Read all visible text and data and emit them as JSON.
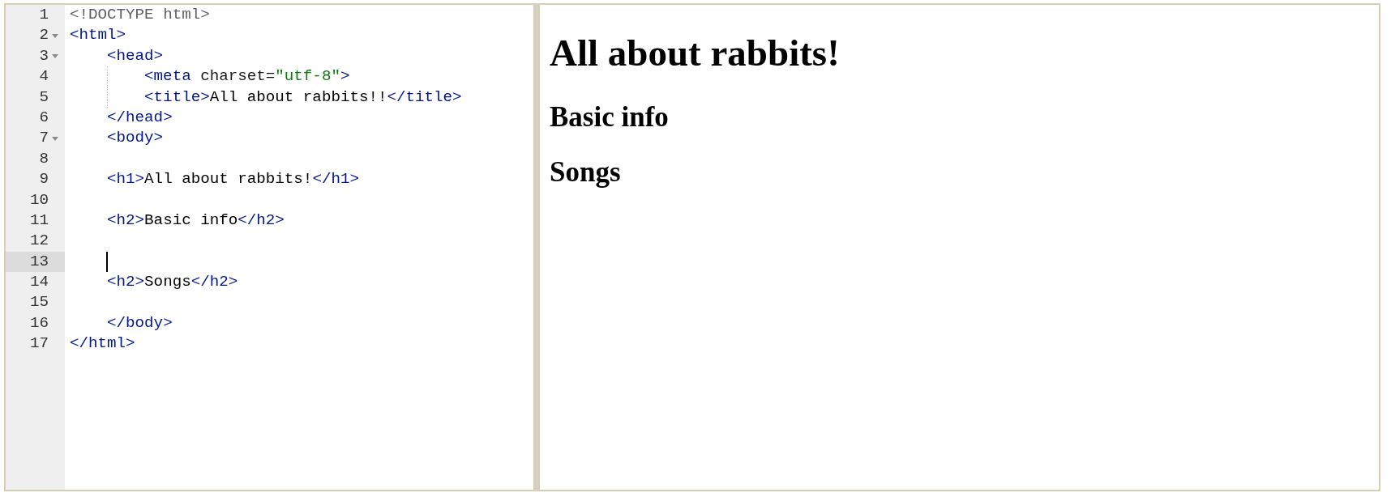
{
  "editor": {
    "lines": [
      {
        "number": "1",
        "foldable": false,
        "active": false,
        "tokens": [
          {
            "kind": "doctype",
            "text": "<!DOCTYPE html>"
          }
        ]
      },
      {
        "number": "2",
        "foldable": true,
        "active": false,
        "tokens": [
          {
            "kind": "tag",
            "text": "<html>"
          }
        ],
        "children": [
          {
            "number": "3",
            "foldable": true,
            "active": false,
            "tokens": [
              {
                "kind": "tag",
                "text": "<head>"
              }
            ],
            "children": [
              {
                "number": "4",
                "foldable": false,
                "active": false,
                "tokens": [
                  {
                    "kind": "tag",
                    "text": "<meta"
                  },
                  {
                    "kind": "attribute",
                    "text": " charset"
                  },
                  {
                    "kind": "punct",
                    "text": "="
                  },
                  {
                    "kind": "string",
                    "text": "\"utf-8\""
                  },
                  {
                    "kind": "tag",
                    "text": ">"
                  }
                ]
              },
              {
                "number": "5",
                "foldable": false,
                "active": false,
                "tokens": [
                  {
                    "kind": "tag",
                    "text": "<title>"
                  },
                  {
                    "kind": "text",
                    "text": "All about rabbits!!"
                  },
                  {
                    "kind": "tag",
                    "text": "</title>"
                  }
                ]
              }
            ]
          },
          {
            "number": "6",
            "foldable": false,
            "active": false,
            "tokens": [
              {
                "kind": "tag",
                "text": "</head>"
              }
            ]
          },
          {
            "number": "7",
            "foldable": true,
            "active": false,
            "tokens": [
              {
                "kind": "tag",
                "text": "<body>"
              }
            ]
          },
          {
            "number": "8",
            "foldable": false,
            "active": false
          },
          {
            "number": "9",
            "foldable": false,
            "active": false,
            "tokens": [
              {
                "kind": "tag",
                "text": "<h1>"
              },
              {
                "kind": "text",
                "text": "All about rabbits!"
              },
              {
                "kind": "tag",
                "text": "</h1>"
              }
            ]
          },
          {
            "number": "10",
            "foldable": false,
            "active": false
          },
          {
            "number": "11",
            "foldable": false,
            "active": false,
            "tokens": [
              {
                "kind": "tag",
                "text": "<h2>"
              },
              {
                "kind": "text",
                "text": "Basic info"
              },
              {
                "kind": "tag",
                "text": "</h2>"
              }
            ]
          },
          {
            "number": "12",
            "foldable": false,
            "active": false
          },
          {
            "number": "13",
            "foldable": false,
            "active": true
          },
          {
            "number": "14",
            "foldable": false,
            "active": false,
            "tokens": [
              {
                "kind": "tag",
                "text": "<h2>"
              },
              {
                "kind": "text",
                "text": "Songs"
              },
              {
                "kind": "tag",
                "text": "</h2>"
              }
            ]
          },
          {
            "number": "15",
            "foldable": false,
            "active": false
          },
          {
            "number": "16",
            "foldable": false,
            "active": false,
            "tokens": [
              {
                "kind": "tag",
                "text": "</body>"
              }
            ]
          }
        ]
      },
      {
        "number": "17",
        "foldable": false,
        "active": false,
        "tokens": [
          {
            "kind": "tag",
            "text": "</html>"
          }
        ]
      }
    ]
  },
  "preview": {
    "headings": [
      {
        "kind": "h1",
        "text": "All about rabbits!"
      },
      {
        "kind": "h2",
        "text": "Basic info"
      },
      {
        "kind": "h2",
        "text": "Songs"
      }
    ]
  }
}
